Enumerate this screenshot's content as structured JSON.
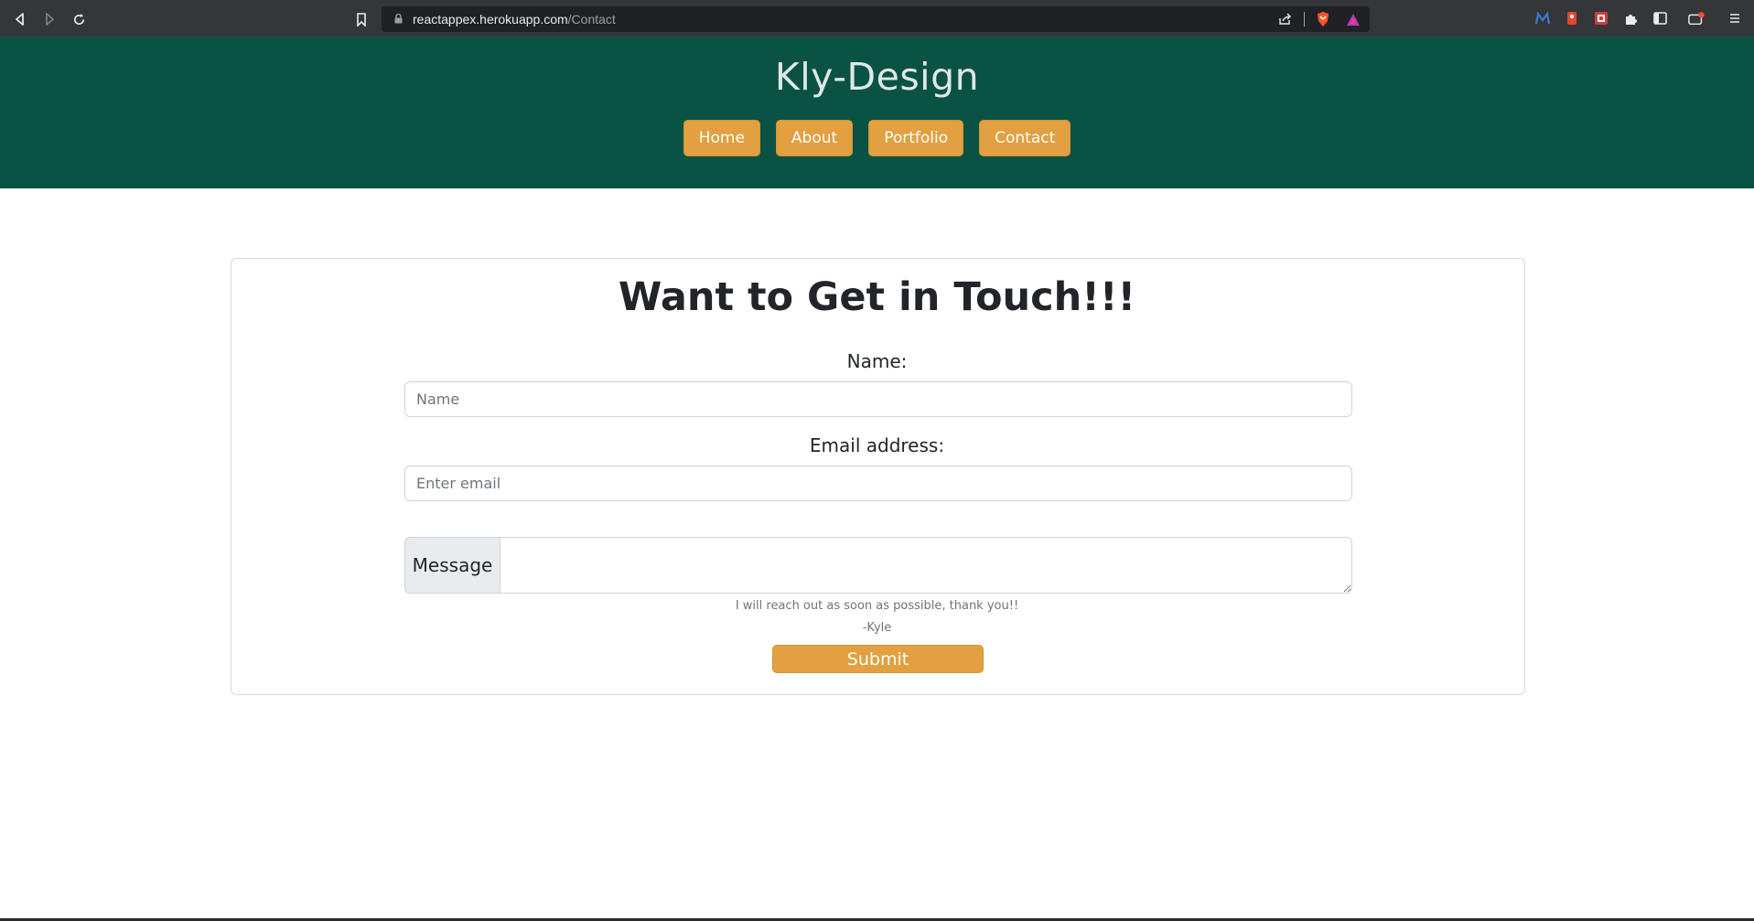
{
  "browser": {
    "url_host": "reactappex.herokuapp.com",
    "url_path": "/Contact",
    "icons": [
      "back-icon",
      "forward-icon",
      "reload-icon",
      "bookmark-icon",
      "lock-icon",
      "share-icon",
      "brave-shield-icon",
      "brave-rewards-icon",
      "extension-m-icon",
      "extension-red-icon",
      "extension-red2-icon",
      "extensions-puzzle-icon",
      "sidebar-icon",
      "wallet-icon",
      "menu-icon"
    ]
  },
  "header": {
    "brand": "Kly-Design",
    "background": "#0a5244",
    "nav": [
      {
        "label": "Home"
      },
      {
        "label": "About"
      },
      {
        "label": "Portfolio"
      },
      {
        "label": "Contact"
      }
    ],
    "accent": "#e2a040"
  },
  "form": {
    "title": "Want to Get in Touch!!!",
    "name_label": "Name:",
    "name_placeholder": "Name",
    "email_label": "Email address:",
    "email_placeholder": "Enter email",
    "message_label": "Message",
    "message_value": "",
    "note_line1": "I will reach out as soon as possible, thank you!!",
    "note_line2": "-Kyle",
    "submit_label": "Submit"
  }
}
